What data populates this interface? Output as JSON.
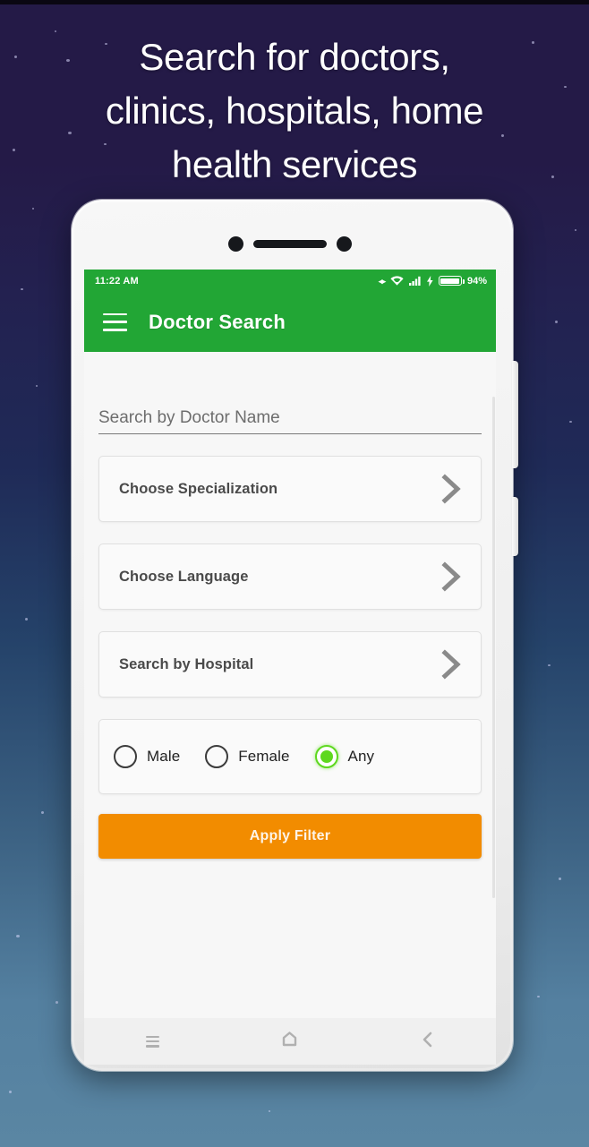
{
  "headline": {
    "line1": "Search for doctors,",
    "line2": "clinics, hospitals, home",
    "line3": "health services"
  },
  "colors": {
    "app_bar_green": "#22A635",
    "accent_orange": "#F28C00",
    "radio_selected_green": "#5ED81F",
    "background_top": "#241A47",
    "background_bottom": "#5A86A3"
  },
  "status_bar": {
    "time": "11:22 AM",
    "data_icon": "data-transfer-icon",
    "wifi_icon": "wifi-icon",
    "signal_icon": "cellular-signal-icon",
    "charging_icon": "charging-bolt-icon",
    "battery_icon": "battery-icon",
    "battery_percent": "94%"
  },
  "app_bar": {
    "menu_icon": "hamburger-menu-icon",
    "title": "Doctor Search"
  },
  "search": {
    "placeholder": "Search by Doctor Name",
    "value": ""
  },
  "options": [
    {
      "label": "Choose Specialization",
      "icon": "chevron-right-icon"
    },
    {
      "label": "Choose Language",
      "icon": "chevron-right-icon"
    },
    {
      "label": "Search by Hospital",
      "icon": "chevron-right-icon"
    }
  ],
  "gender": {
    "selected": "Any",
    "choices": [
      {
        "label": "Male",
        "selected": false
      },
      {
        "label": "Female",
        "selected": false
      },
      {
        "label": "Any",
        "selected": true
      }
    ]
  },
  "apply_button": {
    "label": "Apply Filter"
  },
  "nav_bar": {
    "recents_icon": "recents-icon",
    "home_icon": "home-icon",
    "back_icon": "back-icon"
  }
}
